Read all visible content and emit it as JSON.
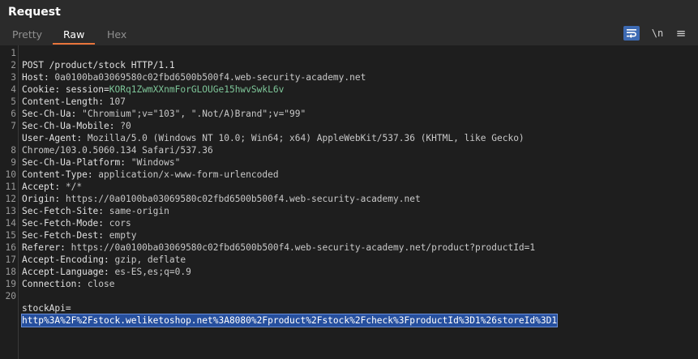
{
  "header": {
    "title": "Request"
  },
  "tabs": [
    {
      "label": "Pretty"
    },
    {
      "label": "Raw"
    },
    {
      "label": "Hex"
    }
  ],
  "toolbar": {
    "newline_label": "\\n",
    "menu_label": "≡"
  },
  "lines": [
    {
      "num": "1",
      "text": "POST /product/stock HTTP/1.1"
    },
    {
      "num": "2",
      "name": "Host: ",
      "value": "0a0100ba03069580c02fbd6500b500f4.web-security-academy.net"
    },
    {
      "num": "3",
      "name": "Cookie: session=",
      "value": "KORq1ZwmXXnmForGLOUGe15hwvSwkL6v"
    },
    {
      "num": "4",
      "name": "Content-Length: ",
      "value": "107"
    },
    {
      "num": "5",
      "name": "Sec-Ch-Ua: ",
      "value": "\"Chromium\";v=\"103\", \".Not/A)Brand\";v=\"99\""
    },
    {
      "num": "6",
      "name": "Sec-Ch-Ua-Mobile: ",
      "value": "?0"
    },
    {
      "num": "7",
      "name": "User-Agent: ",
      "value": "Mozilla/5.0 (Windows NT 10.0; Win64; x64) AppleWebKit/537.36 (KHTML, like Gecko)"
    },
    {
      "num": "",
      "name": "",
      "value": "Chrome/103.0.5060.134 Safari/537.36"
    },
    {
      "num": "8",
      "name": "Sec-Ch-Ua-Platform: ",
      "value": "\"Windows\""
    },
    {
      "num": "9",
      "name": "Content-Type: ",
      "value": "application/x-www-form-urlencoded"
    },
    {
      "num": "10",
      "name": "Accept: ",
      "value": "*/*"
    },
    {
      "num": "11",
      "name": "Origin: ",
      "value": "https://0a0100ba03069580c02fbd6500b500f4.web-security-academy.net"
    },
    {
      "num": "12",
      "name": "Sec-Fetch-Site: ",
      "value": "same-origin"
    },
    {
      "num": "13",
      "name": "Sec-Fetch-Mode: ",
      "value": "cors"
    },
    {
      "num": "14",
      "name": "Sec-Fetch-Dest: ",
      "value": "empty"
    },
    {
      "num": "15",
      "name": "Referer: ",
      "value": "https://0a0100ba03069580c02fbd6500b500f4.web-security-academy.net/product?productId=1"
    },
    {
      "num": "16",
      "name": "Accept-Encoding: ",
      "value": "gzip, deflate"
    },
    {
      "num": "17",
      "name": "Accept-Language: ",
      "value": "es-ES,es;q=0.9"
    },
    {
      "num": "18",
      "name": "Connection: ",
      "value": "close"
    },
    {
      "num": "19",
      "name": "",
      "value": ""
    },
    {
      "num": "20",
      "name": "stockApi=",
      "value": ""
    },
    {
      "num": "",
      "name": "",
      "value": "http%3A%2F%2Fstock.weliketoshop.net%3A8080%2Fproduct%2Fstock%2Fcheck%3FproductId%3D1%26storeId%3D1"
    }
  ],
  "colors": {
    "accent_tab": "#e8743b",
    "wrap_button": "#3d6ab3",
    "cookie_value": "#7ec699",
    "selection": "#264f9e"
  },
  "icons": {
    "wrap": "word-wrap-icon",
    "newline": "newline-toggle-icon",
    "menu": "hamburger-menu-icon"
  }
}
